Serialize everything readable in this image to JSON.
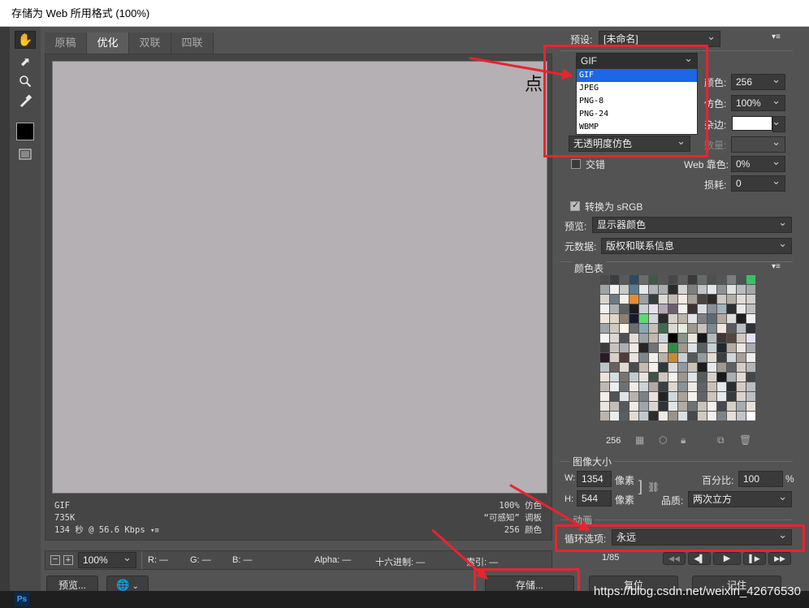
{
  "window": {
    "title": "存储为 Web 所用格式 (100%)"
  },
  "tabs": [
    "原稿",
    "优化",
    "双联",
    "四联"
  ],
  "tools": [
    "hand-icon",
    "slice-select-icon",
    "zoom-icon",
    "eyedropper-icon"
  ],
  "image_info": {
    "left": [
      "GIF",
      "735K",
      "134 秒 @ 56.6 Kbps"
    ],
    "right": [
      "100% 仿色",
      "“可感知” 调板",
      "256 颜色"
    ]
  },
  "partial_char": "点",
  "status_bar": {
    "zoom": "100%",
    "r": "R: —",
    "g": "G: —",
    "b": "B: —",
    "alpha": "Alpha: —",
    "hex": "十六进制: —",
    "index": "索引: —"
  },
  "bottom_buttons": {
    "preview": "预览...",
    "save": "存储...",
    "reset": "复位",
    "remember": "记住"
  },
  "preset": {
    "label": "预设:",
    "value": "[未命名]"
  },
  "format": {
    "selected": "GIF",
    "options": [
      "GIF",
      "JPEG",
      "PNG-8",
      "PNG-24",
      "WBMP"
    ]
  },
  "settings": {
    "colors_label": "颜色:",
    "colors_value": "256",
    "dither_label": "仿色:",
    "dither_value": "100%",
    "matte_label": "杂边:",
    "amount_label": "数量:",
    "transparency_dither": "无透明度仿色",
    "interlaced_label": "交错",
    "web_snap_label": "Web 靠色:",
    "web_snap_value": "0%",
    "lossy_label": "损耗:",
    "lossy_value": "0"
  },
  "convert_srgb": "转换为 sRGB",
  "preview_row": {
    "label": "预览:",
    "value": "显示器颜色"
  },
  "metadata_row": {
    "label": "元数据:",
    "value": "版权和联系信息"
  },
  "color_table": {
    "title": "颜色表",
    "count": "256",
    "colors": [
      "#4c4b4b",
      "#3b3d3e",
      "#575a5c",
      "#2d4a5e",
      "#6a6c6c",
      "#3e5a47",
      "#555555",
      "#484848",
      "#5d5d5d",
      "#3a3a3a",
      "#666a6c",
      "#4f4f4f",
      "#535659",
      "#7a7d7e",
      "#4b5353",
      "#3dbd6a",
      "#9ea3a6",
      "#f0f0f0",
      "#c7c9cb",
      "#5b7b91",
      "#e6e8e9",
      "#b2b5b7",
      "#a9aeb2",
      "#2b2b2b",
      "#d2d4d5",
      "#7c7e80",
      "#c0c4c7",
      "#e0e6ea",
      "#8e9294",
      "#dfe3e4",
      "#b8bcbe",
      "#a4a6a8",
      "#d8d3cc",
      "#6f7b84",
      "#f4efe6",
      "#e58a2f",
      "#9aa0a5",
      "#383c3f",
      "#dedad5",
      "#c2b9ae",
      "#f3ebe2",
      "#a89f97",
      "#4a4340",
      "#2e2a28",
      "#cfc9c3",
      "#b6aea6",
      "#e2dcd6",
      "#d4cfca",
      "#f2f2f2",
      "#aeb2b4",
      "#5e6062",
      "#1c1c1c",
      "#c9cfd3",
      "#e9e1f2",
      "#b3a7b9",
      "#6c5e70",
      "#f7f1ea",
      "#3b3231",
      "#d9dfe2",
      "#8a9096",
      "#a3b3bc",
      "#2c2f30",
      "#eaeaea",
      "#bfbfbf",
      "#f0e8de",
      "#e0d5c7",
      "#8e7f73",
      "#151b30",
      "#58de6b",
      "#cfd8dc",
      "#2a2a2a",
      "#d6d0c8",
      "#bcb3aa",
      "#e2e5e7",
      "#7d8083",
      "#5b6a74",
      "#b1a89f",
      "#dddddd",
      "#1f1f1f",
      "#eef1f2",
      "#9da5aa",
      "#d1c7bd",
      "#fff6ea",
      "#696d70",
      "#8ba7b5",
      "#c7bfb6",
      "#3f6a4f",
      "#dcd8d4",
      "#e8ece0",
      "#a0978e",
      "#c8c2bc",
      "#7c8891",
      "#efe7df",
      "#585c5f",
      "#b7bfc3",
      "#2f3235",
      "#f5f5f5",
      "#dbd6d1",
      "#4d5154",
      "#e4ddd6",
      "#9ba1a5",
      "#c0b7ae",
      "#cdd6da",
      "#000000",
      "#88958d",
      "#eee6dd",
      "#161616",
      "#b4bbbf",
      "#413537",
      "#53463f",
      "#d0c8bf",
      "#e6e1f6",
      "#3a3d40",
      "#c9c3bd",
      "#aaaeb0",
      "#f1e9e1",
      "#262626",
      "#6e7478",
      "#e7dfd7",
      "#2f8a4a",
      "#9f968d",
      "#dde2e5",
      "#5b5f62",
      "#c6d0d5",
      "#1e2a2f",
      "#b5aca4",
      "#ebe6e1",
      "#a6acb0",
      "#281a2a",
      "#d8cfc6",
      "#4d3c3a",
      "#e9e4df",
      "#7f878c",
      "#f2eeea",
      "#b9b1a9",
      "#c58a3a",
      "#cacfd2",
      "#56595b",
      "#939a9e",
      "#e4dcd4",
      "#3c4044",
      "#d1d6d9",
      "#aa9f95",
      "#eeeeee",
      "#bcc3c7",
      "#6a6060",
      "#e0d9d1",
      "#4a4d4f",
      "#c4bbb2",
      "#f6f0ea",
      "#30383c",
      "#dadada",
      "#8f9aa0",
      "#cac2b9",
      "#1d1d1d",
      "#e6eaec",
      "#a19990",
      "#5e6265",
      "#d5cdc5",
      "#b0b6b9",
      "#ece4dc",
      "#d4dde2",
      "#7a7471",
      "#c2cbd0",
      "#e8e3de",
      "#3e5349",
      "#cfc7bf",
      "#f4f1ee",
      "#9e958c",
      "#dfe4e7",
      "#575b5e",
      "#d8d0c8",
      "#1a1a1a",
      "#a8b0b4",
      "#e2dad2",
      "#444749",
      "#c0b8b0",
      "#ebeef0",
      "#6d7174",
      "#f0ebe6",
      "#ccd3d7",
      "#b2aaa2",
      "#3c4043",
      "#dfd7cf",
      "#89939a",
      "#eee9e4",
      "#5f6366",
      "#c9c1b9",
      "#e4e8ea",
      "#2a2d2f",
      "#d3cbc3",
      "#b7bdc0",
      "#f3eee9",
      "#4f5356",
      "#e0e4e6",
      "#bab2aa",
      "#7b8287",
      "#e9e1d9",
      "#242424",
      "#d0d8dc",
      "#aaa199",
      "#f6f1ec",
      "#606467",
      "#ccc4bc",
      "#e5e9eb",
      "#393c3e",
      "#dbd3cb",
      "#bac0c3",
      "#eae5e0",
      "#c5bdb5",
      "#55595c",
      "#f1ece7",
      "#9fa6aa",
      "#dcd4cc",
      "#313437",
      "#e1e5e7",
      "#b3aba3",
      "#6e7275",
      "#cac3bb",
      "#f4efea",
      "#484b4d",
      "#d7cfc7",
      "#a5acb0",
      "#e8e0d8",
      "#bcb4ac",
      "#eaeef0",
      "#5a5e61",
      "#e3dbd3",
      "#c1c9cd",
      "#2c2c2c",
      "#efeae5",
      "#9b9289",
      "#dadfe2",
      "#47494b",
      "#d1c9c1",
      "#f5f0eb",
      "#7e858a",
      "#e6ded6",
      "#bfc5c8",
      "#ffffff"
    ]
  },
  "image_size": {
    "title": "图像大小",
    "w_label": "W:",
    "w_value": "1354",
    "w_unit": "像素",
    "h_label": "H:",
    "h_value": "544",
    "h_unit": "像素",
    "percent_label": "百分比:",
    "percent_value": "100",
    "percent_unit": "%",
    "quality_label": "品质:",
    "quality_value": "两次立方"
  },
  "animation": {
    "title": "动画",
    "loop_label": "循环选项:",
    "loop_value": "永远",
    "frame": "1/85"
  },
  "watermark": "https://blog.csdn.net/weixin_42676530"
}
